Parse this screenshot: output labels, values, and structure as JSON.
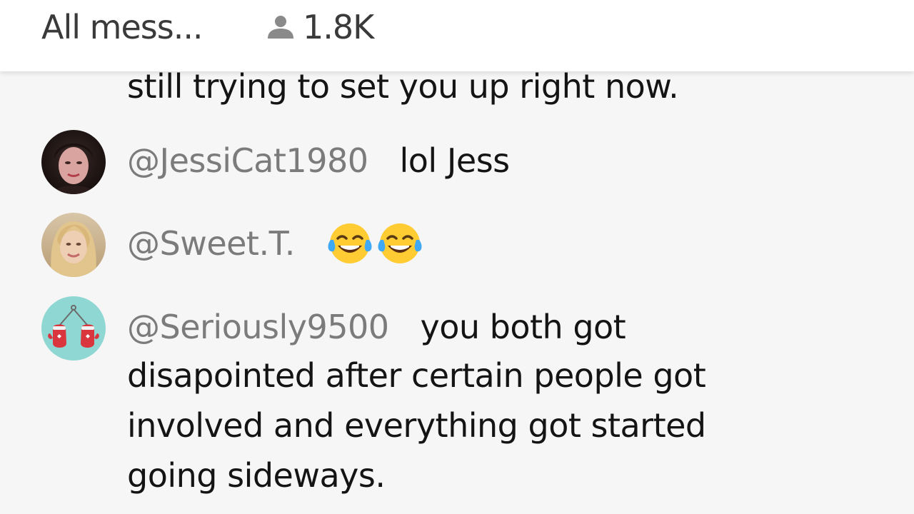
{
  "header": {
    "tab_label": "All mess...",
    "viewer_icon": "person-icon",
    "viewer_count": "1.8K"
  },
  "chat": {
    "partial_line": "still trying to set you up right now.",
    "messages": [
      {
        "handle": "@JessiCat1980",
        "text": "lol Jess",
        "avatar": "profile-photo"
      },
      {
        "handle": "@Sweet.T.",
        "text": "",
        "emoji": [
          "tears-of-joy-emoji",
          "tears-of-joy-emoji"
        ],
        "avatar": "profile-photo"
      },
      {
        "handle": "@Seriously9500",
        "lines": [
          "you both got",
          "disapointed after certain people got",
          "involved and everything got started",
          "going sideways."
        ],
        "avatar": "mittens-icon"
      }
    ]
  },
  "colors": {
    "header_bg": "#ffffff",
    "chat_bg": "#f6f6f6",
    "handle": "#7b7b7b",
    "text": "#141414",
    "avatar_teal": "#8fd7d2",
    "mitten_red": "#d9363e"
  }
}
